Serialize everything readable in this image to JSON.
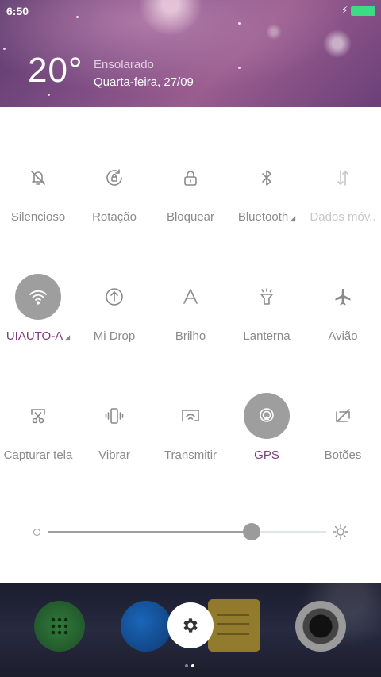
{
  "status_bar": {
    "time": "6:50",
    "battery_color": "#3ddc84",
    "charging": true
  },
  "weather": {
    "temperature": "20°",
    "condition": "Ensolarado",
    "date": "Quarta-feira, 27/09"
  },
  "toggles": [
    [
      {
        "label": "Silencioso",
        "icon": "bell-off-icon",
        "active": false
      },
      {
        "label": "Rotação",
        "icon": "rotation-lock-icon",
        "active": false
      },
      {
        "label": "Bloquear",
        "icon": "lock-icon",
        "active": false
      },
      {
        "label": "Bluetooth",
        "icon": "bluetooth-icon",
        "active": false,
        "has_menu": true
      },
      {
        "label": "Dados móv..",
        "icon": "mobile-data-icon",
        "active": false,
        "disabled": true
      }
    ],
    [
      {
        "label": "UIAUTO-A",
        "icon": "wifi-icon",
        "active": true,
        "has_menu": true
      },
      {
        "label": "Mi Drop",
        "icon": "mi-drop-icon",
        "active": false
      },
      {
        "label": "Brilho",
        "icon": "brightness-auto-icon",
        "active": false
      },
      {
        "label": "Lanterna",
        "icon": "flashlight-icon",
        "active": false
      },
      {
        "label": "Avião",
        "icon": "airplane-icon",
        "active": false
      }
    ],
    [
      {
        "label": "Capturar tela",
        "icon": "screenshot-scissors-icon",
        "active": false
      },
      {
        "label": "Vibrar",
        "icon": "vibrate-icon",
        "active": false
      },
      {
        "label": "Transmitir",
        "icon": "cast-icon",
        "active": false
      },
      {
        "label": "GPS",
        "icon": "gps-icon",
        "active": true
      },
      {
        "label": "Botões",
        "icon": "buttons-off-icon",
        "active": false
      }
    ]
  ],
  "brightness": {
    "level": 0.73
  },
  "colors": {
    "active_circle": "#9e9e9e",
    "active_label": "#7a3c78",
    "inactive_label": "#8a8a8a"
  },
  "dock": {
    "apps": [
      "dialer-icon",
      "browser-icon",
      "notes-icon",
      "camera-icon"
    ],
    "settings_icon": "gear-icon",
    "page_count": 2,
    "current_page": 2
  }
}
